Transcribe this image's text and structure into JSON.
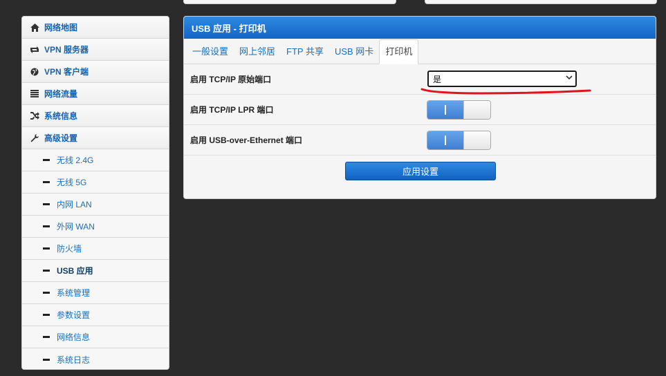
{
  "sidebar": {
    "items": [
      {
        "icon": "home-icon",
        "label": "网络地图"
      },
      {
        "icon": "vpn-server-icon",
        "label": "VPN 服务器"
      },
      {
        "icon": "globe-icon",
        "label": "VPN 客户端"
      },
      {
        "icon": "traffic-list-icon",
        "label": "网络流量"
      },
      {
        "icon": "shuffle-icon",
        "label": "系统信息"
      },
      {
        "icon": "wrench-icon",
        "label": "高级设置"
      }
    ],
    "subitems": [
      {
        "label": "无线 2.4G"
      },
      {
        "label": "无线 5G"
      },
      {
        "label": "内网 LAN"
      },
      {
        "label": "外网 WAN"
      },
      {
        "label": "防火墙"
      },
      {
        "label": "USB 应用",
        "active": true
      },
      {
        "label": "系统管理"
      },
      {
        "label": "参数设置"
      },
      {
        "label": "网络信息"
      },
      {
        "label": "系统日志"
      }
    ]
  },
  "panel": {
    "title": "USB 应用 - 打印机",
    "tabs": [
      "一般设置",
      "网上邻居",
      "FTP 共享",
      "USB 网卡",
      "打印机"
    ],
    "active_tab": "打印机",
    "settings": [
      {
        "label": "启用 TCP/IP 原始端口",
        "control": "select",
        "value": "是"
      },
      {
        "label": "启用 TCP/IP LPR 端口",
        "control": "toggle",
        "value": "on"
      },
      {
        "label": "启用 USB-over-Ethernet 端口",
        "control": "toggle",
        "value": "on"
      }
    ],
    "apply_label": "应用设置"
  },
  "colors": {
    "accent": "#1a6fb8",
    "header_blue": "#1464c6",
    "annotation_red": "#e0141e",
    "background": "#2b2b2b"
  }
}
